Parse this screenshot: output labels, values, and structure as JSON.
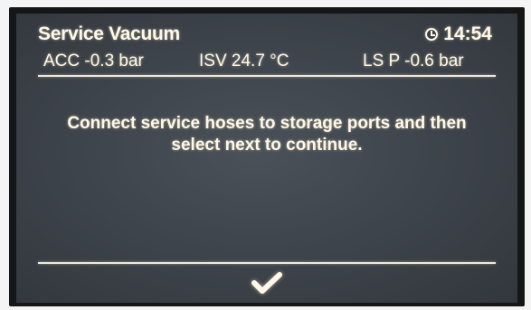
{
  "header": {
    "title": "Service Vacuum",
    "clock_icon": "clock-icon",
    "time": "14:54"
  },
  "status": {
    "acc": "ACC  -0.3 bar",
    "isv": "ISV  24.7 °C",
    "ls_p": "LS P -0.6 bar"
  },
  "message": {
    "line1": "Connect service hoses to storage ports and then",
    "line2": "select next to continue."
  },
  "footer": {
    "next_icon": "checkmark-icon"
  },
  "colors": {
    "text": "#fff8e8",
    "screen_bg": "#3f454c",
    "bezel": "#141618"
  }
}
